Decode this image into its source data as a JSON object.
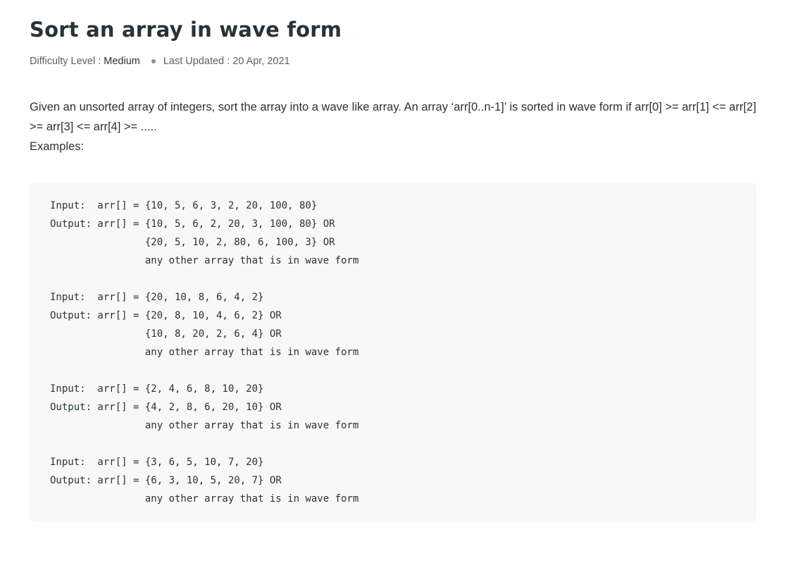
{
  "article": {
    "title": "Sort an array in wave form",
    "meta": {
      "difficulty_label": "Difficulty Level :",
      "difficulty_value": "Medium",
      "updated_label": "Last Updated :",
      "updated_value": "20 Apr, 2021"
    },
    "description": "Given an unsorted array of integers, sort the array into a wave like array. An array ‘arr[0..n-1]’ is sorted in wave form if arr[0] >= arr[1] <= arr[2] >= arr[3] <= arr[4] >= .....",
    "examples_label": "Examples:",
    "code_lines": [
      "Input:  arr[] = {10, 5, 6, 3, 2, 20, 100, 80}",
      "Output: arr[] = {10, 5, 6, 2, 20, 3, 100, 80} OR",
      "                {20, 5, 10, 2, 80, 6, 100, 3} OR",
      "                any other array that is in wave form",
      "",
      "Input:  arr[] = {20, 10, 8, 6, 4, 2}",
      "Output: arr[] = {20, 8, 10, 4, 6, 2} OR",
      "                {10, 8, 20, 2, 6, 4} OR",
      "                any other array that is in wave form",
      "",
      "Input:  arr[] = {2, 4, 6, 8, 10, 20}",
      "Output: arr[] = {4, 2, 8, 6, 20, 10} OR",
      "                any other array that is in wave form",
      "",
      "Input:  arr[] = {3, 6, 5, 10, 7, 20}",
      "Output: arr[] = {6, 3, 10, 5, 20, 7} OR",
      "                any other array that is in wave form"
    ]
  }
}
